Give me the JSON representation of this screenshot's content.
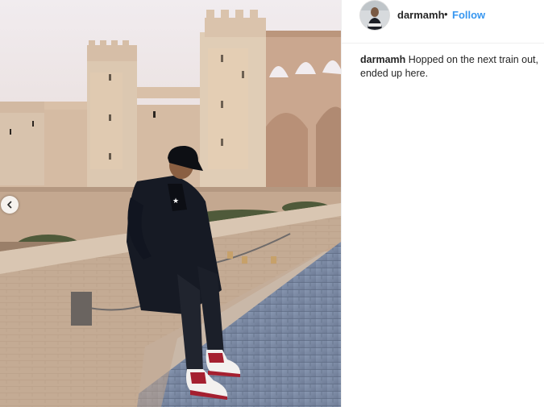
{
  "post": {
    "username": "darmamh",
    "separator": "•",
    "follow_label": "Follow",
    "caption_username": "darmamh",
    "caption_text": "Hopped on the next train out, ended up here."
  },
  "photo": {
    "subject": "man in black coat, cap and red-white sneakers sitting on a stone bridge wall in front of a castle"
  },
  "icons": {
    "prev": "chevron-left-icon"
  },
  "colors": {
    "follow": "#3897f0",
    "text": "#262626",
    "divider": "#efefef"
  }
}
